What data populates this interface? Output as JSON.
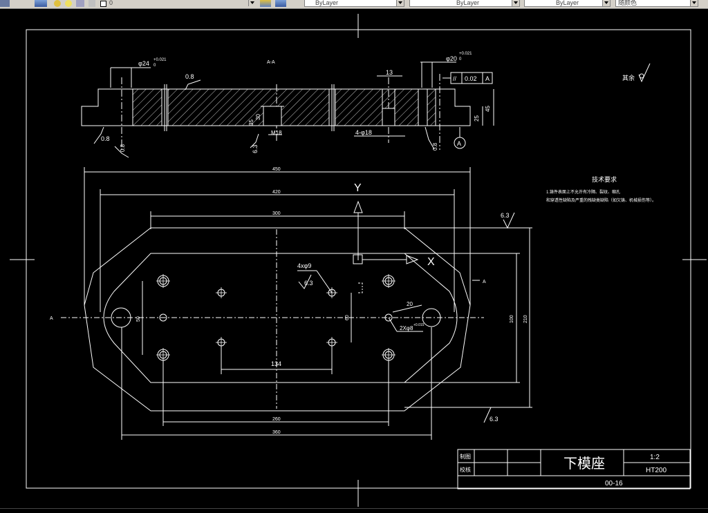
{
  "toolbar": {
    "layer_value": "0",
    "color_value": "ByLayer",
    "linetype_value": "ByLayer",
    "lineweight_value": "ByLayer",
    "plotstyle_value": "随颜色"
  },
  "drawing": {
    "section_label": "A-A",
    "section_marker_left": "A",
    "section_marker_right": "A",
    "surface_finish_rest": "其余",
    "dims": {
      "hole24": "φ24",
      "hole24_tol": "+0.021",
      "hole24_tol2": "0",
      "hole20": "φ20",
      "hole20_tol": "+0.021",
      "hole20_tol2": "0",
      "rough08_top": "0.8",
      "rough08_left": "0.8",
      "rough08_right": "0.8",
      "rough08_small": "0.8",
      "dim13": "13",
      "parallel_symbol": "//",
      "parallel_tol": "0.02",
      "parallel_datum": "A",
      "datum_circle": "A",
      "dim25": "25",
      "dim45": "45",
      "dim35": "35",
      "dim30": "30",
      "m18": "M18",
      "rough63_sec": "6.3",
      "holes4x18": "4-φ18",
      "dim450": "450",
      "dim420": "420",
      "dim300": "300",
      "axis_y": "Y",
      "axis_x": "X",
      "rough63_top": "6.3",
      "rough63_bottom": "6.3",
      "holes4x9": "4xφ9",
      "rough63_mid": "6.3",
      "dim20": "20",
      "dim50": "50",
      "dim60": "60",
      "dim2x8": "2Xφ8",
      "dim2x8_tol": "+0.015",
      "dim100": "100",
      "dim210": "210",
      "dim134": "134",
      "dim260": "260",
      "dim360": "360"
    },
    "tech_title": "技术要求",
    "tech_line1": "1.铸件表面上不允许有冷隔、裂纹、缩孔",
    "tech_line2": "和穿透性缺陷及严重的残缺类缺陷（如欠铸、机械损伤等）。",
    "title_block": {
      "draw_label": "制图",
      "check_label": "校核",
      "part_name": "下模座",
      "scale": "1:2",
      "material": "HT200",
      "drawing_no": "00-16"
    }
  },
  "colors": {
    "background": "#000000",
    "line": "#ffffff",
    "toolbar": "#d4d0c8"
  }
}
